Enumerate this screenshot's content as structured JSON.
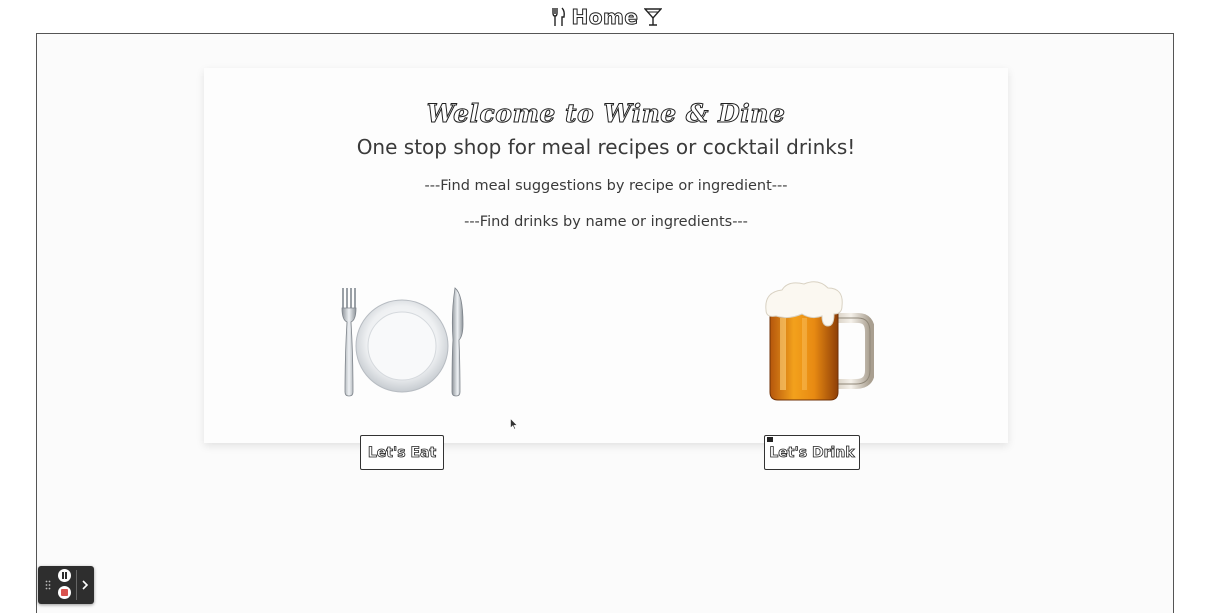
{
  "nav": {
    "title": "Home",
    "left_icon": "fork-knife-icon",
    "right_icon": "cocktail-icon"
  },
  "hero": {
    "welcome": "Welcome to Wine & Dine",
    "tagline": "One stop shop for meal recipes or cocktail drinks!",
    "line_meals": "---Find meal suggestions by recipe or ingredient---",
    "line_drinks": "---Find drinks by name or ingredients---"
  },
  "food": {
    "icon": "plate-with-cutlery-icon",
    "button_label": "Let's Eat"
  },
  "drink": {
    "icon": "beer-mug-icon",
    "button_label": "Let's Drink"
  },
  "recorder": {
    "icons": [
      "grip-icon",
      "pause-icon",
      "stop-icon",
      "chevron-right-icon"
    ]
  },
  "colors": {
    "page_background": "#fbfbfb",
    "card_background": "#fdfdfd",
    "text": "#3a3a3a",
    "recorder_background": "#2e2e2e",
    "stop_red": "#d9534f"
  }
}
